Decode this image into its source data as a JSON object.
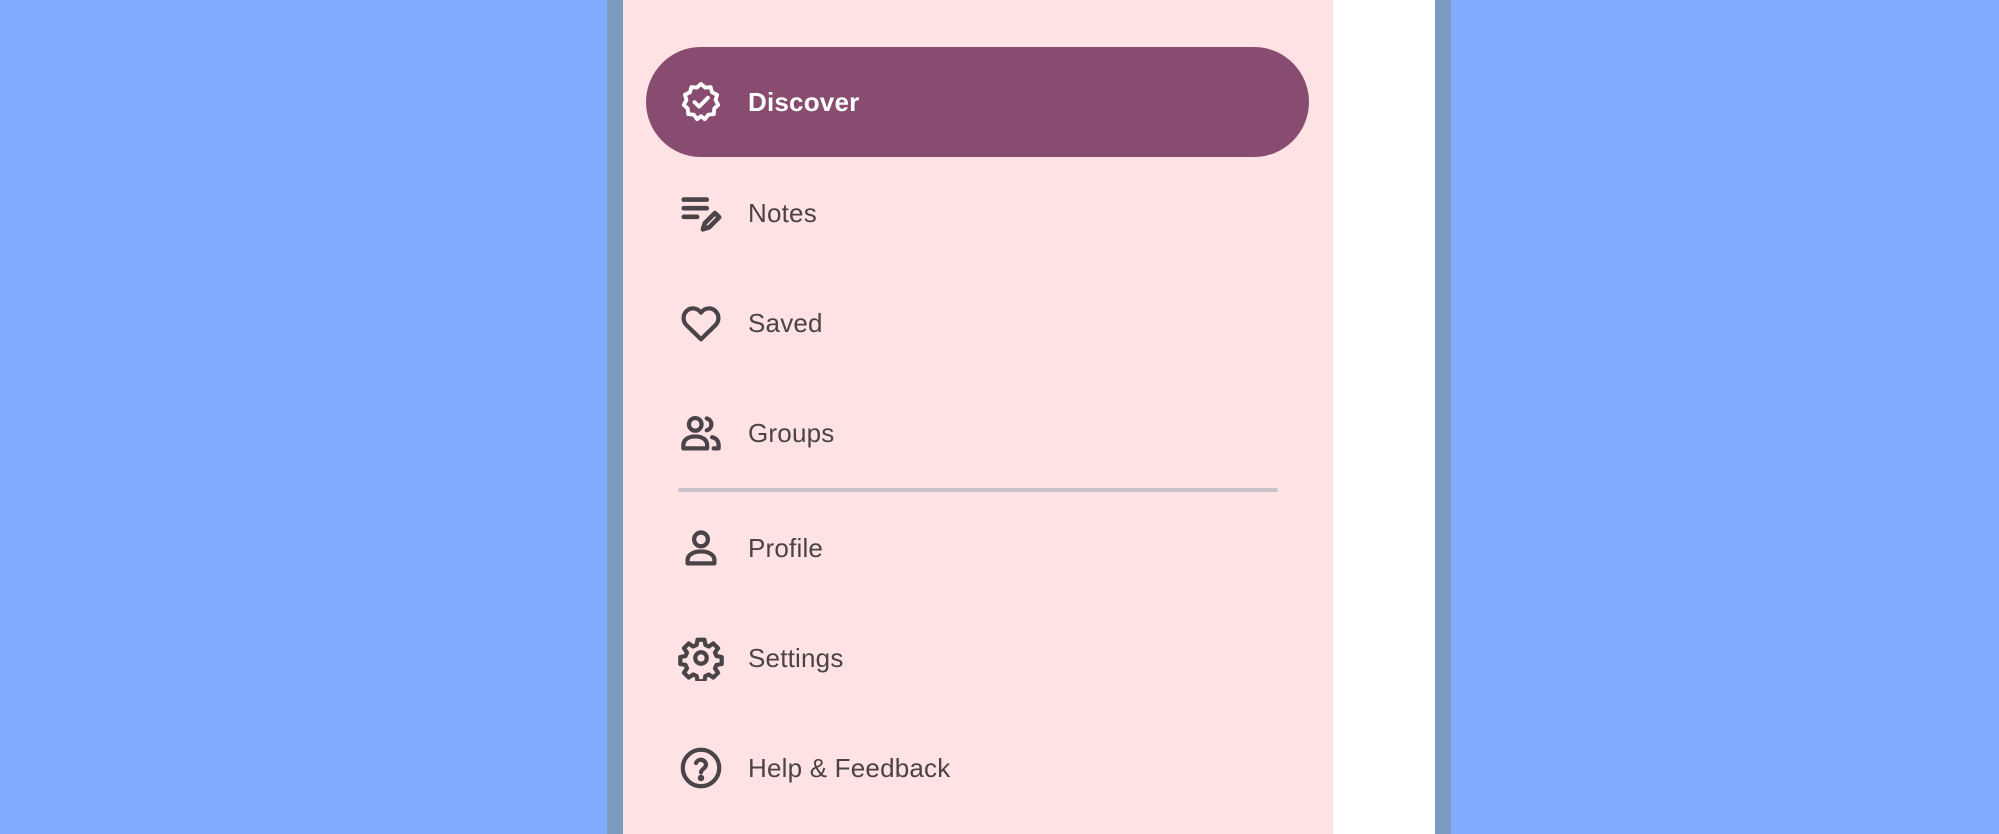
{
  "colors": {
    "background": "#80abfe",
    "drawer_background": "#ffe2e3",
    "active_item": "#874c6f",
    "active_text": "#ffffff",
    "item_text": "#4a4348",
    "divider": "#c9c0c8"
  },
  "drawer": {
    "primary_items": [
      {
        "label": "Discover",
        "icon": "verified-badge-icon",
        "active": true
      },
      {
        "label": "Notes",
        "icon": "notes-edit-icon",
        "active": false
      },
      {
        "label": "Saved",
        "icon": "heart-icon",
        "active": false
      },
      {
        "label": "Groups",
        "icon": "groups-icon",
        "active": false
      }
    ],
    "secondary_items": [
      {
        "label": "Profile",
        "icon": "person-icon",
        "active": false
      },
      {
        "label": "Settings",
        "icon": "gear-icon",
        "active": false
      },
      {
        "label": "Help & Feedback",
        "icon": "help-icon",
        "active": false
      }
    ]
  }
}
